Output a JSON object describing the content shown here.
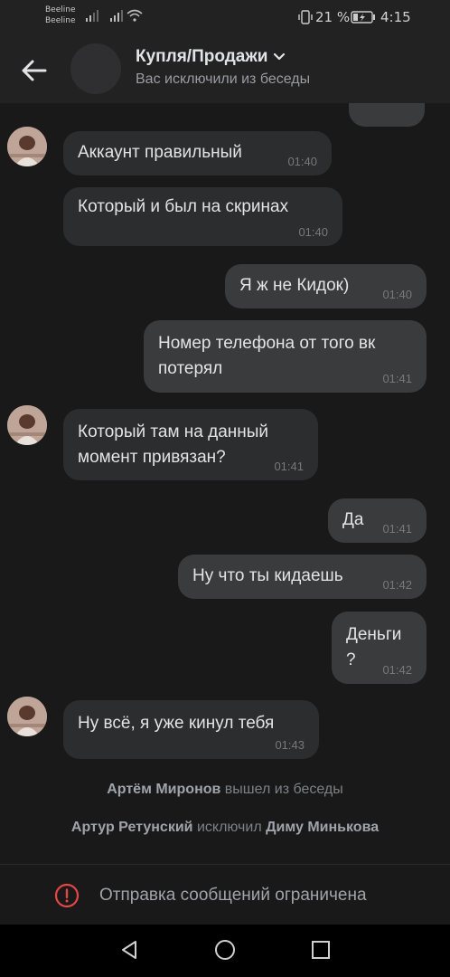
{
  "status_bar": {
    "carrier_1": "Beeline",
    "carrier_2": "Beeline",
    "battery": "21 %",
    "time": "4:15"
  },
  "header": {
    "title": "Купля/Продажи",
    "subtitle": "Вас исключили из беседы"
  },
  "messages": [
    {
      "text": "Аккаунт правильный",
      "time": "01:40",
      "direction": "in"
    },
    {
      "text": "Который и был на скринах",
      "time": "01:40",
      "direction": "in"
    },
    {
      "text": "Я ж не Кидок)",
      "time": "01:40",
      "direction": "out"
    },
    {
      "text_line_1": "Номер телефона от того вк",
      "text_line_2": "потерял",
      "time": "01:41",
      "direction": "out"
    },
    {
      "text_line_1": "Который там на данный",
      "text_line_2": "момент привязан?",
      "time": "01:41",
      "direction": "in"
    },
    {
      "text": "Да",
      "time": "01:41",
      "direction": "out"
    },
    {
      "text": "Ну что ты кидаешь",
      "time": "01:42",
      "direction": "out"
    },
    {
      "text_line_1": "Деньги",
      "text_line_2": "?",
      "time": "01:42",
      "direction": "out"
    },
    {
      "text": "Ну всё, я уже кинул тебя",
      "time": "01:43",
      "direction": "in"
    }
  ],
  "service_messages": [
    {
      "actor": "Артём Миронов",
      "action": "вышел из беседы"
    },
    {
      "actor": "Артур Ретунский",
      "action": "исключил",
      "target": "Диму Минькова"
    }
  ],
  "composer": {
    "restricted_text": "Отправка сообщений ограничена"
  },
  "colors": {
    "background": "#19191a",
    "bubble": "#2c2d2e",
    "accent_alert": "#e64646"
  }
}
